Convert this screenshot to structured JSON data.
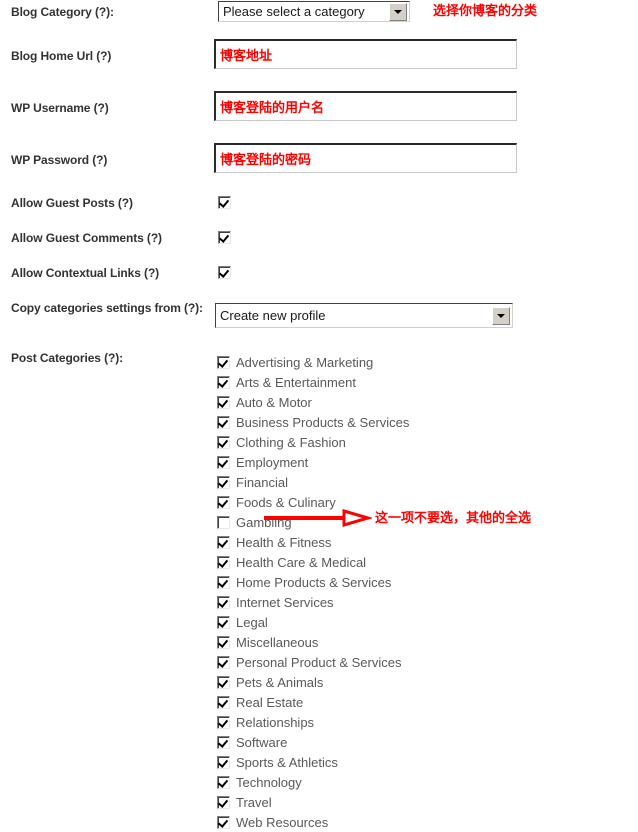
{
  "colors": {
    "annotation_red": "#ff0000",
    "label_text": "#333333",
    "category_text": "#595959",
    "input_value_red": "#ff0000",
    "page_background": "#ffffff"
  },
  "fields": [
    {
      "label": "Blog Category (?):",
      "control": "select",
      "value": "Please select a category"
    },
    {
      "label": "Blog Home Url (?)",
      "control": "text",
      "value": "博客地址"
    },
    {
      "label": "WP Username (?)",
      "control": "text",
      "value": "博客登陆的用户名"
    },
    {
      "label": "WP Password (?)",
      "control": "text",
      "value": "博客登陆的密码"
    },
    {
      "label": "Allow Guest Posts (?)",
      "control": "checkbox",
      "checked": true
    },
    {
      "label": "Allow Guest Comments (?)",
      "control": "checkbox",
      "checked": true
    },
    {
      "label": "Allow Contextual Links (?)",
      "control": "checkbox",
      "checked": true
    },
    {
      "label": "Copy categories settings from (?):",
      "control": "select",
      "value": "Create new profile"
    },
    {
      "label": "Post Categories (?):",
      "control": "checkbox-list"
    }
  ],
  "labels": {
    "blog_category": "Blog Category (?):",
    "blog_home_url": "Blog Home Url (?)",
    "wp_username": "WP Username (?)",
    "wp_password": "WP Password (?)",
    "allow_guest_posts": "Allow Guest Posts (?)",
    "allow_guest_comments": "Allow Guest Comments (?)",
    "allow_contextual_links": "Allow Contextual Links (?)",
    "copy_categories_settings": "Copy categories settings from (?):",
    "post_categories": "Post Categories (?):"
  },
  "values": {
    "blog_category_select": "Please select a category",
    "blog_home_url": "博客地址",
    "wp_username": "博客登陆的用户名",
    "wp_password": "博客登陆的密码",
    "copy_categories_select": "Create new profile"
  },
  "categories": [
    {
      "label": "Advertising & Marketing",
      "checked": true
    },
    {
      "label": "Arts & Entertainment",
      "checked": true
    },
    {
      "label": "Auto & Motor",
      "checked": true
    },
    {
      "label": "Business Products & Services",
      "checked": true
    },
    {
      "label": "Clothing & Fashion",
      "checked": true
    },
    {
      "label": "Employment",
      "checked": true
    },
    {
      "label": "Financial",
      "checked": true
    },
    {
      "label": "Foods & Culinary",
      "checked": true
    },
    {
      "label": "Gambling",
      "checked": false
    },
    {
      "label": "Health & Fitness",
      "checked": true
    },
    {
      "label": "Health Care & Medical",
      "checked": true
    },
    {
      "label": "Home Products & Services",
      "checked": true
    },
    {
      "label": "Internet Services",
      "checked": true
    },
    {
      "label": "Legal",
      "checked": true
    },
    {
      "label": "Miscellaneous",
      "checked": true
    },
    {
      "label": "Personal Product & Services",
      "checked": true
    },
    {
      "label": "Pets & Animals",
      "checked": true
    },
    {
      "label": "Real Estate",
      "checked": true
    },
    {
      "label": "Relationships",
      "checked": true
    },
    {
      "label": "Software",
      "checked": true
    },
    {
      "label": "Sports & Athletics",
      "checked": true
    },
    {
      "label": "Technology",
      "checked": true
    },
    {
      "label": "Travel",
      "checked": true
    },
    {
      "label": "Web Resources",
      "checked": true
    }
  ],
  "annotations": {
    "blog_category_note": "选择你博客的分类",
    "gambling_note": "这一项不要选，其他的全选"
  }
}
